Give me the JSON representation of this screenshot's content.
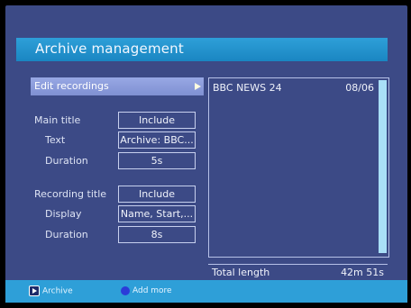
{
  "header": {
    "title": "Archive management"
  },
  "menu": {
    "edit_recordings": "Edit recordings",
    "main_title": {
      "label": "Main title",
      "value": "Include"
    },
    "text": {
      "label": "Text",
      "value": "Archive: BBC..."
    },
    "main_duration": {
      "label": "Duration",
      "value": "5s"
    },
    "recording_title": {
      "label": "Recording title",
      "value": "Include"
    },
    "display": {
      "label": "Display",
      "value": "Name, Start,..."
    },
    "recording_duration": {
      "label": "Duration",
      "value": "8s"
    }
  },
  "recordings": {
    "items": [
      {
        "name": "BBC NEWS 24",
        "date": "08/06"
      }
    ],
    "total_label": "Total length",
    "total_value": "42m 51s"
  },
  "footer": {
    "archive_label": "Archive",
    "add_more_label": "Add more"
  },
  "colors": {
    "background": "#3c4a86",
    "title_bar": "#2e9fd8",
    "highlight": "#8c9ddc",
    "scrollbar": "#a9dff7",
    "blue_key": "#2b3cd8"
  }
}
